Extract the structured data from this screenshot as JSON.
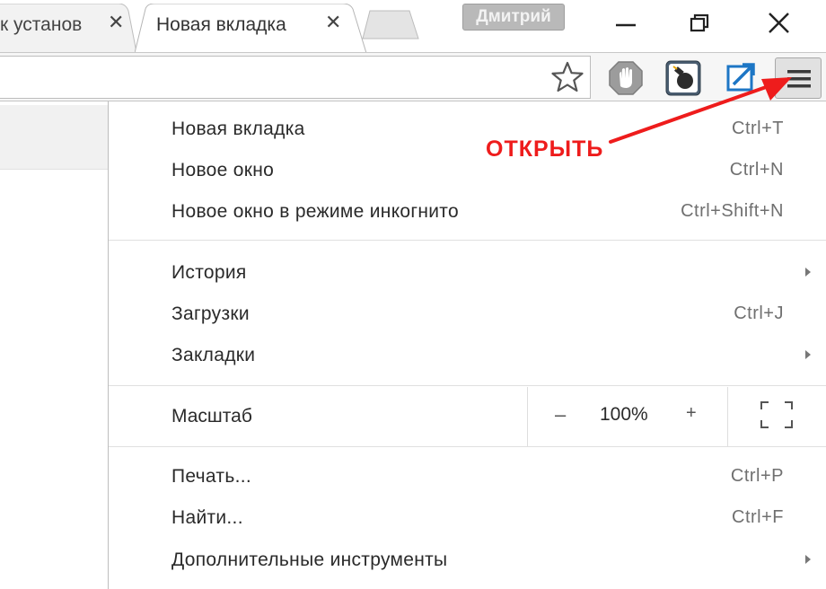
{
  "tabs": [
    {
      "title": "к установ",
      "close": "✕"
    },
    {
      "title": "Новая вкладка",
      "close": "✕"
    }
  ],
  "profile": {
    "name": "Дмитрий"
  },
  "icons": {
    "star": "bookmark-star-icon",
    "adblock": "adblock-hand-icon",
    "bomb": "bomb-extension-icon",
    "link": "external-link-icon",
    "menu": "hamburger-menu-icon"
  },
  "menu": {
    "group1": [
      {
        "label": "Новая вкладка",
        "shortcut": "Ctrl+T"
      },
      {
        "label": "Новое окно",
        "shortcut": "Ctrl+N"
      },
      {
        "label": "Новое окно в режиме инкогнито",
        "shortcut": "Ctrl+Shift+N"
      }
    ],
    "group2": [
      {
        "label": "История",
        "shortcut": "",
        "submenu": true
      },
      {
        "label": "Загрузки",
        "shortcut": "Ctrl+J",
        "submenu": false
      },
      {
        "label": "Закладки",
        "shortcut": "",
        "submenu": true
      }
    ],
    "zoom": {
      "label": "Масштаб",
      "minus": "–",
      "value": "100%",
      "plus": "+"
    },
    "group3": [
      {
        "label": "Печать...",
        "shortcut": "Ctrl+P"
      },
      {
        "label": "Найти...",
        "shortcut": "Ctrl+F"
      },
      {
        "label": "Дополнительные инструменты",
        "shortcut": "",
        "submenu": true
      }
    ]
  },
  "annotation": {
    "text": "ОТКРЫТЬ",
    "color": "#ee1c1c"
  }
}
